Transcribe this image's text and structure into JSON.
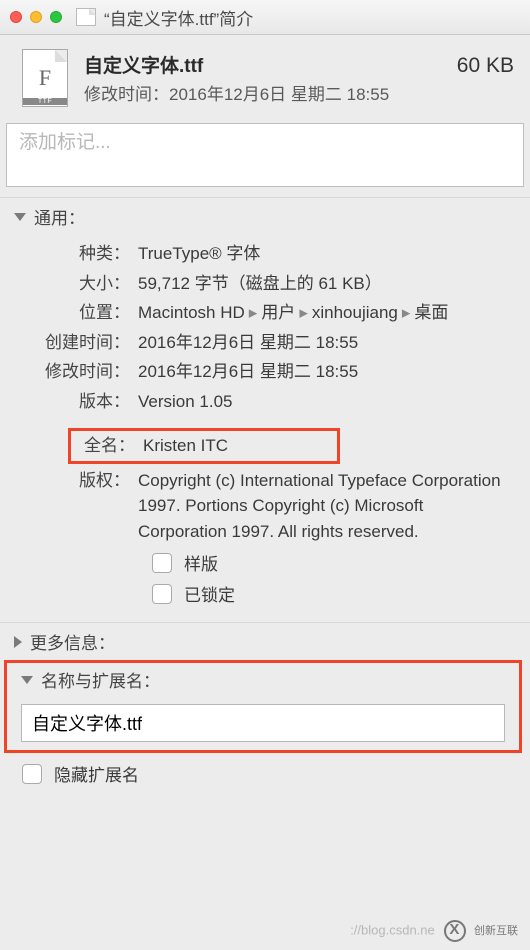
{
  "titlebar": {
    "title": "“自定义字体.ttf”简介"
  },
  "header": {
    "icon_letter": "F",
    "icon_badge": "TTF",
    "filename": "自定义字体.ttf",
    "filesize": "60 KB",
    "modified_label": "修改时间：",
    "modified_value": "2016年12月6日 星期二 18:55"
  },
  "tags": {
    "placeholder": "添加标记..."
  },
  "general": {
    "heading": "通用：",
    "rows": {
      "kind_label": "种类：",
      "kind_value": "TrueType® 字体",
      "size_label": "大小：",
      "size_value": "59,712 字节（磁盘上的 61 KB）",
      "where_label": "位置：",
      "where_p1": "Macintosh HD",
      "where_p2": "用户",
      "where_p3": "xinhoujiang",
      "where_p4": "桌面",
      "created_label": "创建时间：",
      "created_value": "2016年12月6日 星期二 18:55",
      "modified_label": "修改时间：",
      "modified_value": "2016年12月6日 星期二 18:55",
      "version_label": "版本：",
      "version_value": "Version 1.05",
      "fullname_label": "全名：",
      "fullname_value": "Kristen ITC",
      "copyright_label": "版权：",
      "copyright_value": "Copyright (c) International Typeface Corporation 1997. Portions Copyright (c) Microsoft Corporation 1997.  All rights reserved."
    },
    "stationery_label": "样版",
    "locked_label": "已锁定"
  },
  "more_info": {
    "heading": "更多信息："
  },
  "name_ext": {
    "heading": "名称与扩展名：",
    "value": "自定义字体.ttf",
    "hide_ext_label": "隐藏扩展名"
  },
  "watermark": {
    "url": "://blog.csdn.ne",
    "brand": "创新互联"
  }
}
